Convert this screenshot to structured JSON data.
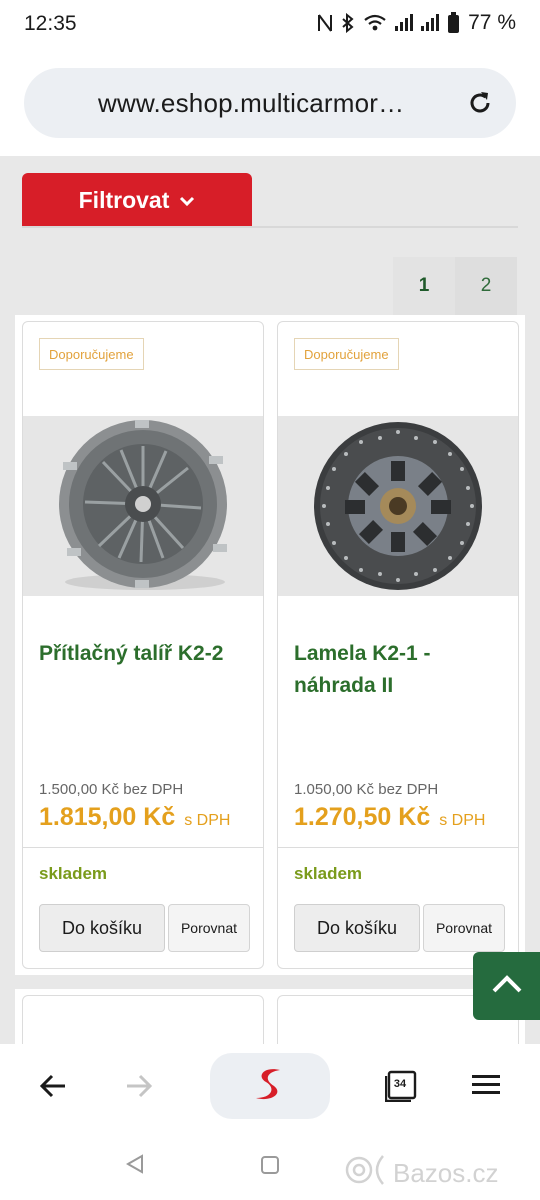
{
  "status": {
    "time": "12:35",
    "battery_percent": "77 %",
    "icons": [
      "nfc-icon",
      "bluetooth-icon",
      "wifi-icon",
      "signal-icon",
      "signal-icon",
      "battery-icon"
    ]
  },
  "browser": {
    "url": "www.eshop.multicarmor…",
    "tab_count": "34",
    "icons": [
      "reload-icon",
      "back-arrow-icon",
      "forward-arrow-icon",
      "home-logo-icon",
      "tabs-icon",
      "menu-icon"
    ]
  },
  "filter": {
    "label": "Filtrovat",
    "icon": "chevron-down-icon"
  },
  "pagination": {
    "pages": [
      "1",
      "2"
    ],
    "current": "1"
  },
  "products": [
    {
      "badge": "Doporučujeme",
      "title": "Přítlačný talíř K2-2",
      "price_excl": "1.500,00 Kč bez DPH",
      "price_incl": "1.815,00 Kč",
      "vat_label": "s DPH",
      "stock": "skladem",
      "cart_label": "Do košíku",
      "compare_label": "Porovnat",
      "image": "pressure-plate-photo"
    },
    {
      "badge": "Doporučujeme",
      "title": "Lamela K2-1 - náhrada II",
      "price_excl": "1.050,00 Kč bez DPH",
      "price_incl": "1.270,50 Kč",
      "vat_label": "s DPH",
      "stock": "skladem",
      "cart_label": "Do košíku",
      "compare_label": "Porovnat",
      "image": "clutch-disc-photo"
    }
  ],
  "watermark": "Bazos.cz",
  "colors": {
    "filter_red": "#d71e28",
    "title_green": "#2c6e2c",
    "price_orange": "#e4a01d",
    "stock_green": "#7a9b1b",
    "scroll_top_green": "#256b3e"
  }
}
